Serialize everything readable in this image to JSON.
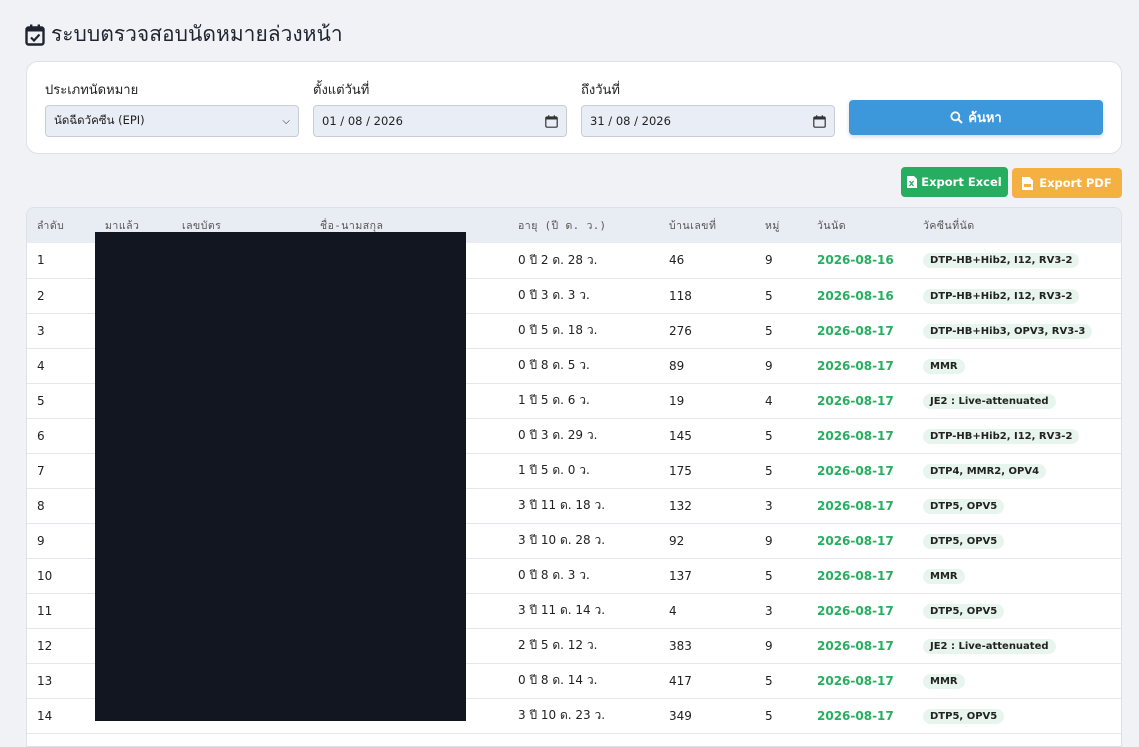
{
  "title": "ระบบตรวจสอบนัดหมายล่วงหน้า",
  "filters": {
    "type_label": "ประเภทนัดหมาย",
    "type_value": "นัดฉีดวัคซีน (EPI)",
    "from_label": "ตั้งแต่วันที่",
    "from_value": "01 / 08 / 2026",
    "to_label": "ถึงวันที่",
    "to_value": "31 / 08 / 2026",
    "search_label": "ค้นหา"
  },
  "exports": {
    "excel": "Export Excel",
    "pdf": "Export PDF"
  },
  "colors": {
    "accent": "#3d97db",
    "excel": "#27ad60",
    "pdf": "#f5b042",
    "date": "#27ae60"
  },
  "table": {
    "headers": [
      "ลำดับ",
      "มาแล้ว",
      "เลขบัตร",
      "ชื่อ-นามสกุล",
      "อายุ (ปี ด. ว.)",
      "บ้านเลขที่",
      "หมู่",
      "วันนัด",
      "วัคซีนที่นัด"
    ],
    "rows": [
      {
        "no": "1",
        "age": "0 ปี 2 ด. 28 ว.",
        "house": "46",
        "moo": "9",
        "date": "2026-08-16",
        "vaccine": "DTP-HB+Hib2, I12, RV3-2"
      },
      {
        "no": "2",
        "age": "0 ปี 3 ด. 3 ว.",
        "house": "118",
        "moo": "5",
        "date": "2026-08-16",
        "vaccine": "DTP-HB+Hib2, I12, RV3-2"
      },
      {
        "no": "3",
        "age": "0 ปี 5 ด. 18 ว.",
        "house": "276",
        "moo": "5",
        "date": "2026-08-17",
        "vaccine": "DTP-HB+Hib3, OPV3, RV3-3"
      },
      {
        "no": "4",
        "age": "0 ปี 8 ด. 5 ว.",
        "house": "89",
        "moo": "9",
        "date": "2026-08-17",
        "vaccine": "MMR"
      },
      {
        "no": "5",
        "age": "1 ปี 5 ด. 6 ว.",
        "house": "19",
        "moo": "4",
        "date": "2026-08-17",
        "vaccine": "JE2 : Live-attenuated"
      },
      {
        "no": "6",
        "age": "0 ปี 3 ด. 29 ว.",
        "house": "145",
        "moo": "5",
        "date": "2026-08-17",
        "vaccine": "DTP-HB+Hib2, I12, RV3-2"
      },
      {
        "no": "7",
        "age": "1 ปี 5 ด. 0 ว.",
        "house": "175",
        "moo": "5",
        "date": "2026-08-17",
        "vaccine": "DTP4, MMR2, OPV4"
      },
      {
        "no": "8",
        "age": "3 ปี 11 ด. 18 ว.",
        "house": "132",
        "moo": "3",
        "date": "2026-08-17",
        "vaccine": "DTP5, OPV5"
      },
      {
        "no": "9",
        "age": "3 ปี 10 ด. 28 ว.",
        "house": "92",
        "moo": "9",
        "date": "2026-08-17",
        "vaccine": "DTP5, OPV5"
      },
      {
        "no": "10",
        "age": "0 ปี 8 ด. 3 ว.",
        "house": "137",
        "moo": "5",
        "date": "2026-08-17",
        "vaccine": "MMR"
      },
      {
        "no": "11",
        "age": "3 ปี 11 ด. 14 ว.",
        "house": "4",
        "moo": "3",
        "date": "2026-08-17",
        "vaccine": "DTP5, OPV5"
      },
      {
        "no": "12",
        "age": "2 ปี 5 ด. 12 ว.",
        "house": "383",
        "moo": "9",
        "date": "2026-08-17",
        "vaccine": "JE2 : Live-attenuated"
      },
      {
        "no": "13",
        "age": "0 ปี 8 ด. 14 ว.",
        "house": "417",
        "moo": "5",
        "date": "2026-08-17",
        "vaccine": "MMR"
      },
      {
        "no": "14",
        "age": "3 ปี 10 ด. 23 ว.",
        "house": "349",
        "moo": "5",
        "date": "2026-08-17",
        "vaccine": "DTP5, OPV5"
      }
    ]
  }
}
